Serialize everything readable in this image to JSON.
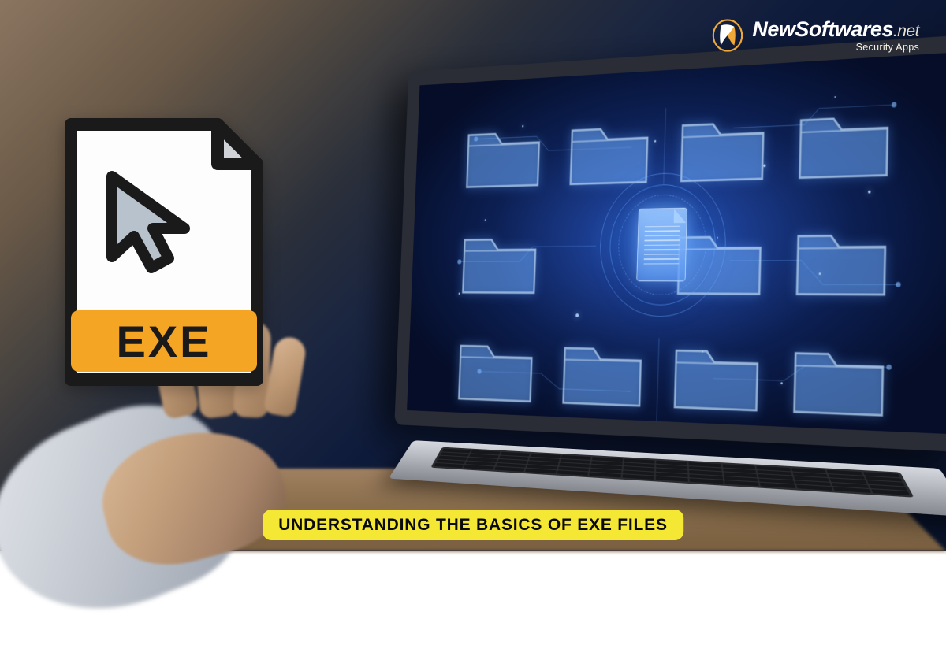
{
  "brand": {
    "name": "NewSoftwares",
    "tld": ".net",
    "tagline": "Security Apps"
  },
  "exe_icon": {
    "label": "EXE"
  },
  "caption": "UNDERSTANDING THE BASICS OF EXE FILES",
  "colors": {
    "accent_yellow": "#f5e834",
    "exe_band": "#f5a524",
    "hologram_blue": "#5fa5ff"
  }
}
